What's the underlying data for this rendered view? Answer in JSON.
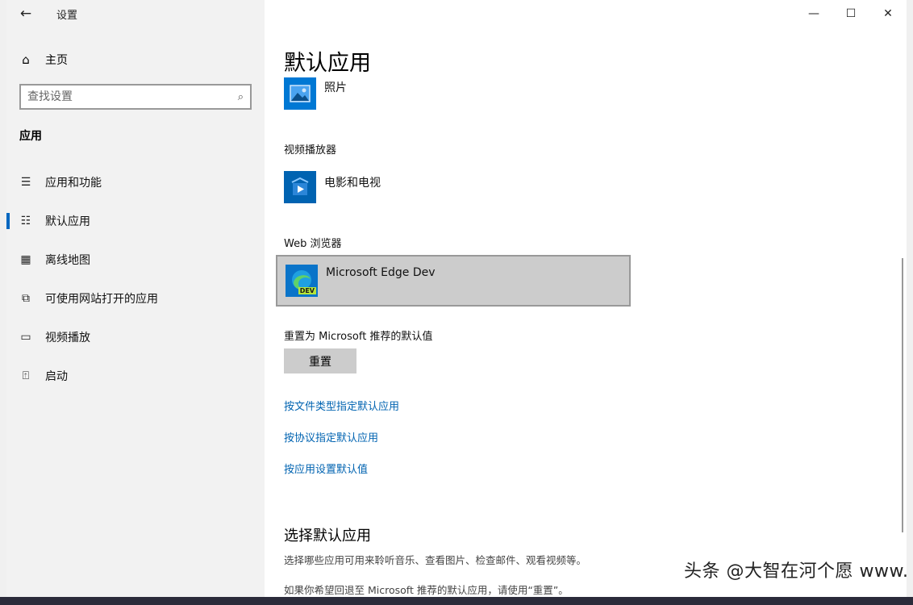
{
  "titlebar": {
    "back_icon": "back-arrow-icon",
    "app_title": "设置",
    "minimize": "—",
    "maximize": "☐",
    "close": "✕"
  },
  "sidebar": {
    "home_label": "主页",
    "search_placeholder": "查找设置",
    "section_title": "应用",
    "items": [
      {
        "label": "应用和功能",
        "icon": "list-icon"
      },
      {
        "label": "默认应用",
        "icon": "default-apps-icon",
        "active": true
      },
      {
        "label": "离线地图",
        "icon": "map-icon"
      },
      {
        "label": "可使用网站打开的应用",
        "icon": "open-link-icon"
      },
      {
        "label": "视频播放",
        "icon": "video-icon"
      },
      {
        "label": "启动",
        "icon": "startup-icon"
      }
    ]
  },
  "main": {
    "page_title": "默认应用",
    "photo_app": "照片",
    "video_category": "视频播放器",
    "video_app": "电影和电视",
    "browser_category": "Web 浏览器",
    "browser_app": "Microsoft Edge Dev",
    "browser_badge": "DEV",
    "reset_label": "重置为 Microsoft 推荐的默认值",
    "reset_button": "重置",
    "links": [
      "按文件类型指定默认应用",
      "按协议指定默认应用",
      "按应用设置默认值"
    ],
    "choose_title": "选择默认应用",
    "choose_desc": "选择哪些应用可用来聆听音乐、查看图片、检查邮件、观看视频等。",
    "reset_hint": "如果你希望回退至 Microsoft 推荐的默认应用，请使用“重置”。"
  },
  "watermark": "头条 @大智在河个愿 www.ziti.cn软荐网",
  "colors": {
    "accent": "#0067c0",
    "link": "#0063b1",
    "sidebar_bg": "#f2f2f2",
    "selected_bg": "#cccccc"
  }
}
